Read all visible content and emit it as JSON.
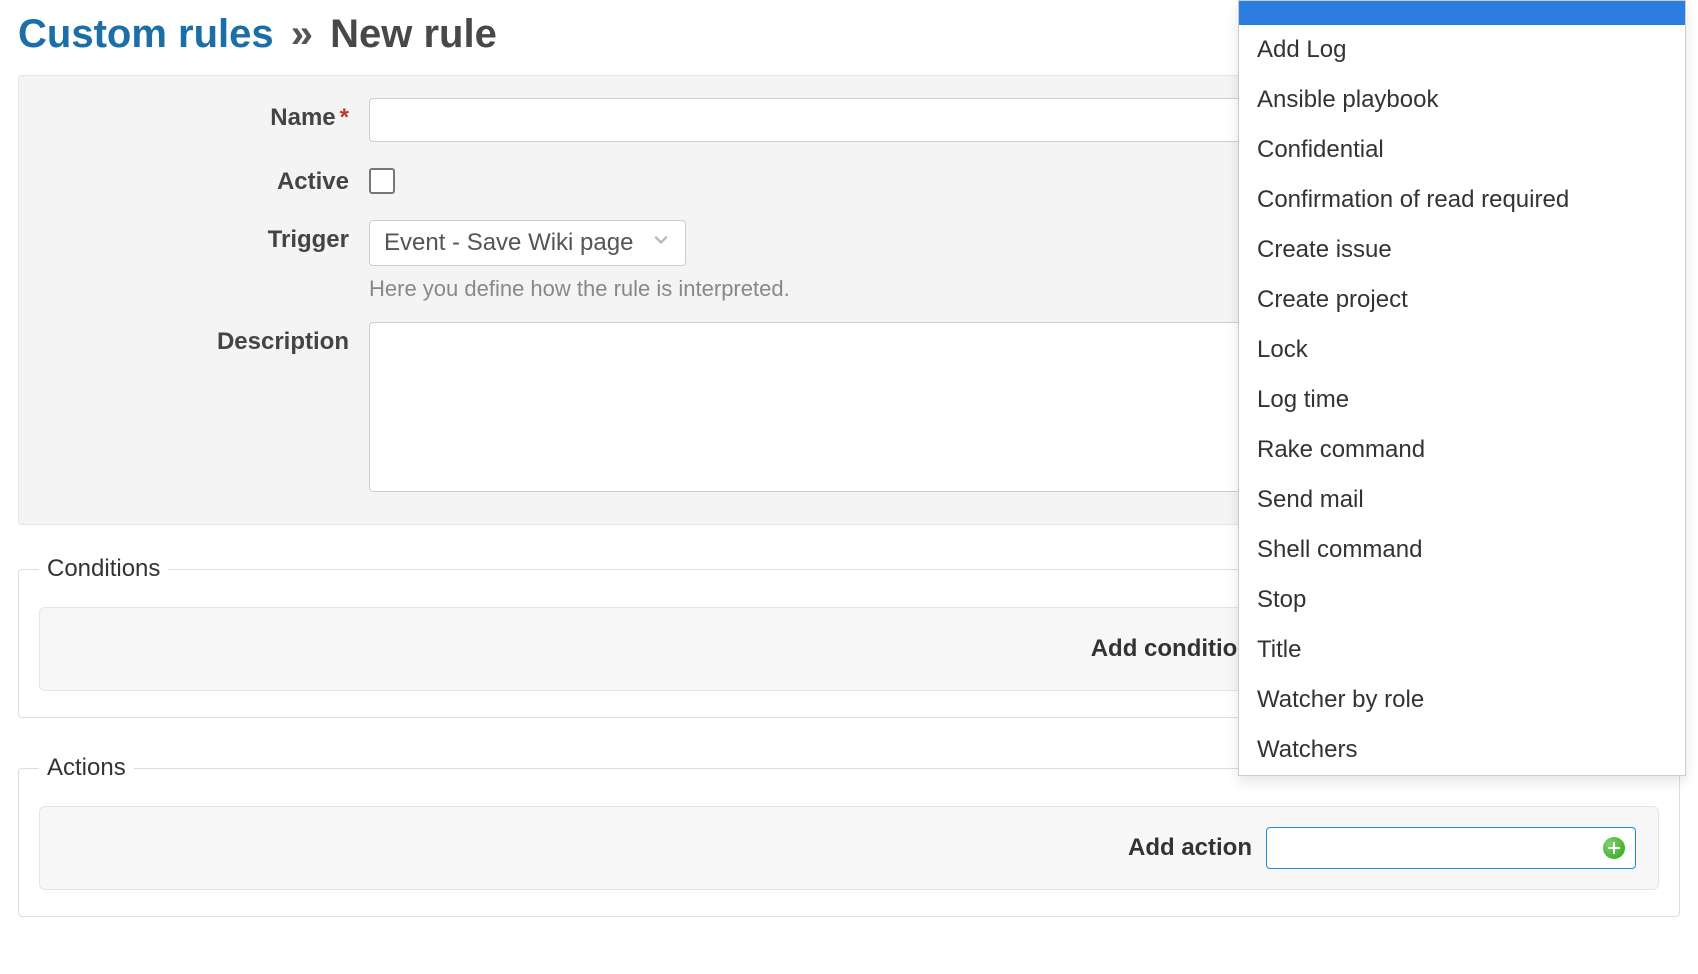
{
  "breadcrumb": {
    "root": "Custom rules",
    "current": "New rule",
    "separator": "»"
  },
  "labels": {
    "name": "Name",
    "active": "Active",
    "trigger": "Trigger",
    "description": "Description",
    "required_marker": "*"
  },
  "fields": {
    "name_value": "",
    "active_checked": false,
    "trigger_value": "Event - Save Wiki page",
    "trigger_hint": "Here you define how the rule is interpreted.",
    "description_value": ""
  },
  "sections": {
    "conditions": {
      "legend": "Conditions",
      "add_label": "Add condition"
    },
    "actions": {
      "legend": "Actions",
      "add_label": "Add action"
    }
  },
  "action_dropdown": {
    "highlighted": "",
    "options": [
      "Add Log",
      "Ansible playbook",
      "Confidential",
      "Confirmation of read required",
      "Create issue",
      "Create project",
      "Lock",
      "Log time",
      "Rake command",
      "Send mail",
      "Shell command",
      "Stop",
      "Title",
      "Watcher by role",
      "Watchers"
    ]
  }
}
